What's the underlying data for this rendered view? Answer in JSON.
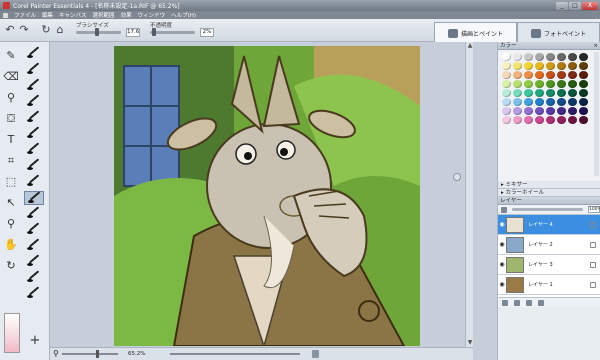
{
  "window": {
    "title": "Corel Painter Essentials 4 - [名称未設定-1a.RIF @ 65.2%]",
    "minimize": "_",
    "maximize": "□",
    "close": "X"
  },
  "menu": [
    "ファイル",
    "編集",
    "キャンバス",
    "選択範囲",
    "効果",
    "ウィンドウ",
    "ヘルプ(H)"
  ],
  "property_bar": {
    "size_label": "ブラシサイズ",
    "size_value": "17.6",
    "opacity_label": "不透明度",
    "opacity_value": "2%"
  },
  "panel_tabs": [
    {
      "label": "描画とペイント",
      "active": true
    },
    {
      "label": "フォトペイント",
      "active": false
    }
  ],
  "color_panel": {
    "title": "カラー",
    "swatch_colors": [
      "#ffffff",
      "#e8e8e8",
      "#c8c8c8",
      "#a8a8a8",
      "#888888",
      "#686868",
      "#484848",
      "#282828",
      "#f7f1c0",
      "#f4e66a",
      "#f5d330",
      "#e8b91e",
      "#d29a16",
      "#b07a10",
      "#8a5c0c",
      "#603c06",
      "#f4d9b8",
      "#f0b47a",
      "#ee8e44",
      "#e26a1c",
      "#c8501a",
      "#a33c16",
      "#7c2a12",
      "#5a1c0c",
      "#d8f0a8",
      "#b8e070",
      "#90cc44",
      "#6eb22a",
      "#4e961e",
      "#387816",
      "#285c10",
      "#18400a",
      "#b8ecd8",
      "#78dcb8",
      "#3cc898",
      "#20a87c",
      "#168c64",
      "#10704e",
      "#0a543a",
      "#063826",
      "#b8dcf4",
      "#7cc0ec",
      "#40a0e0",
      "#2080c8",
      "#1864a8",
      "#124c88",
      "#0c3868",
      "#082448",
      "#d8c8f0",
      "#b49ce4",
      "#9070d4",
      "#7050c0",
      "#5838a4",
      "#442888",
      "#321c6c",
      "#201050",
      "#f4c8e0",
      "#ec9cc8",
      "#e070ac",
      "#cc4890",
      "#b03074",
      "#90205c",
      "#701444",
      "#500c30"
    ],
    "mixer": "ミキサー",
    "color_wheel": "カラーホイール"
  },
  "layers_panel": {
    "title": "レイヤー",
    "opacity": "100%",
    "layers": [
      {
        "name": "レイヤー 4",
        "selected": true
      },
      {
        "name": "レイヤー 2",
        "selected": false
      },
      {
        "name": "レイヤー 3",
        "selected": false
      },
      {
        "name": "レイヤー 1",
        "selected": false
      }
    ]
  },
  "status": {
    "zoom": "65.2%"
  },
  "toolbox": {
    "tools": [
      "brush-tool",
      "eraser-tool",
      "dropper-tool",
      "fill-tool",
      "text-tool",
      "crop-tool",
      "selection-tool",
      "transform-tool",
      "magnifier-tool",
      "grabber-tool",
      "rotate-tool"
    ]
  }
}
